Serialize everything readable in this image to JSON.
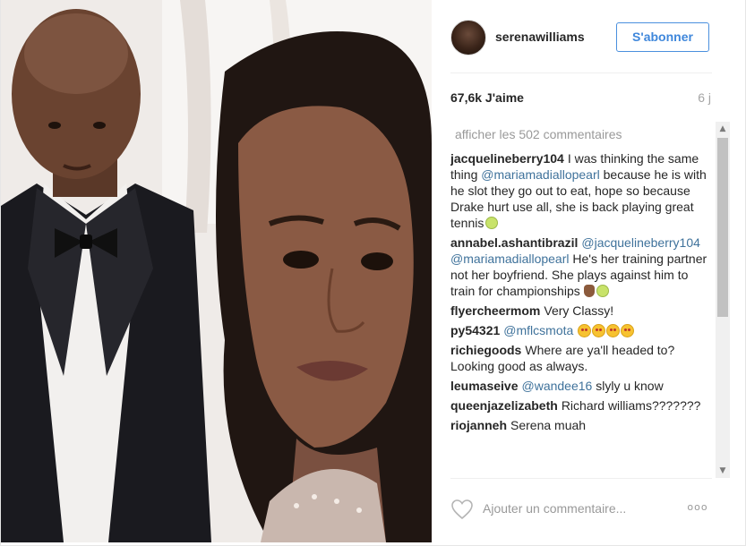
{
  "post": {
    "username": "serenawilliams",
    "follow_label": "S'abonner",
    "likes": "67,6k J'aime",
    "time_ago": "6 j",
    "view_all": "afficher les 502 commentaires"
  },
  "comments": [
    {
      "user": "jacquelineberry104",
      "parts": [
        {
          "t": "text",
          "v": "I was thinking the same thing "
        },
        {
          "t": "mention",
          "v": "@mariamadiallopearl"
        },
        {
          "t": "text",
          "v": " because he is with he slot they go out to eat, hope so because Drake hurt use all, she is back playing great tennis"
        },
        {
          "t": "emoji",
          "v": "tennis"
        }
      ]
    },
    {
      "user": "annabel.ashantibrazil",
      "parts": [
        {
          "t": "mention",
          "v": "@jacquelineberry104"
        },
        {
          "t": "text",
          "v": " "
        },
        {
          "t": "mention",
          "v": "@mariamadiallopearl"
        },
        {
          "t": "text",
          "v": " He's her training partner not her boyfriend. She plays against him to train for championships"
        },
        {
          "t": "emoji",
          "v": "hand"
        },
        {
          "t": "emoji",
          "v": "tennis"
        }
      ]
    },
    {
      "user": "flyercheermom",
      "parts": [
        {
          "t": "text",
          "v": "Very Classy!"
        }
      ]
    },
    {
      "user": "py54321",
      "parts": [
        {
          "t": "mention",
          "v": "@mflcsmota"
        },
        {
          "t": "text",
          "v": " "
        },
        {
          "t": "emoji",
          "v": "smiley"
        },
        {
          "t": "emoji",
          "v": "smiley"
        },
        {
          "t": "emoji",
          "v": "smiley"
        },
        {
          "t": "emoji",
          "v": "smiley"
        }
      ]
    },
    {
      "user": "richiegoods",
      "parts": [
        {
          "t": "text",
          "v": "Where are ya'll headed to? Looking good as always."
        }
      ]
    },
    {
      "user": "leumaseive",
      "parts": [
        {
          "t": "mention",
          "v": "@wandee16"
        },
        {
          "t": "text",
          "v": " slyly u know"
        }
      ]
    },
    {
      "user": "queenjazelizabeth",
      "parts": [
        {
          "t": "text",
          "v": "Richard williams???????"
        }
      ]
    },
    {
      "user": "riojanneh",
      "parts": [
        {
          "t": "text",
          "v": "Serena muah"
        }
      ]
    }
  ],
  "footer": {
    "comment_placeholder": "Ajouter un commentaire...",
    "more_label": "ooo"
  },
  "icons": {
    "heart": "heart-outline-icon",
    "more": "more-options-icon",
    "scroll_up": "scroll-up-arrow-icon",
    "scroll_down": "scroll-down-arrow-icon"
  },
  "colors": {
    "follow_blue": "#3f87db",
    "mention_blue": "#3f729b",
    "muted_text": "#999999"
  }
}
